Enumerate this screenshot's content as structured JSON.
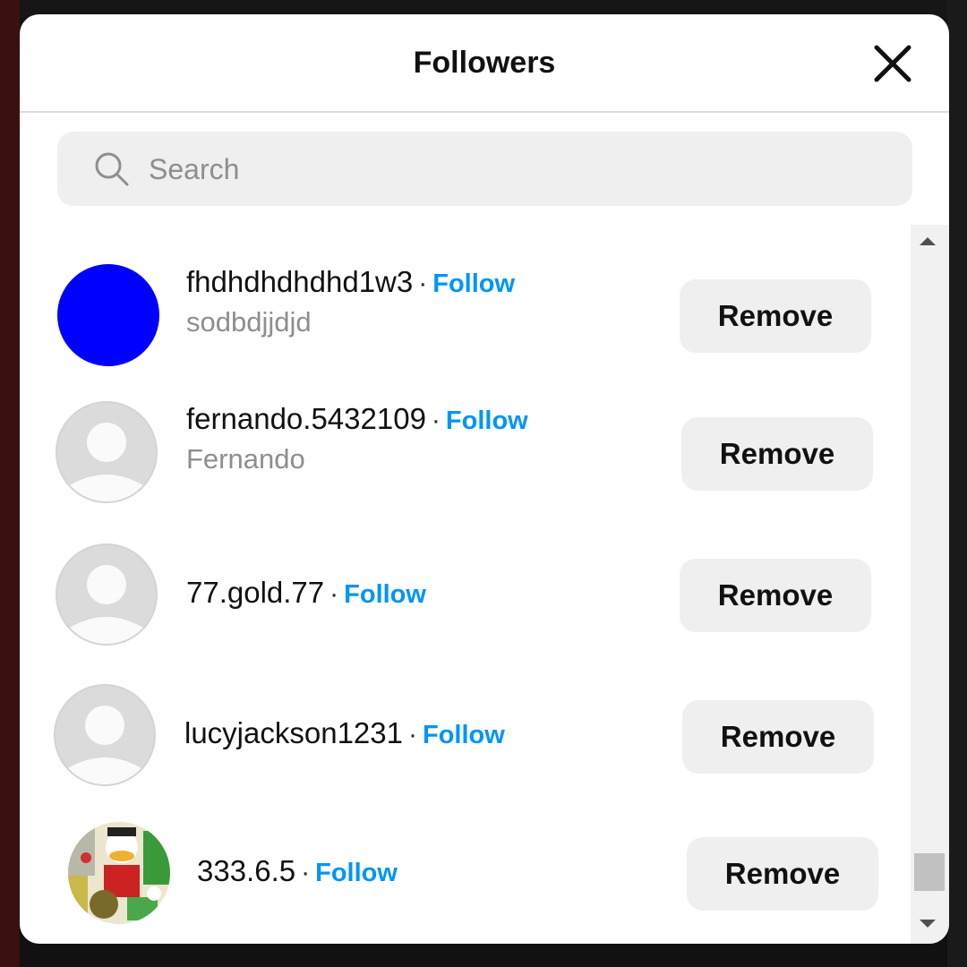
{
  "modal": {
    "title": "Followers"
  },
  "search": {
    "placeholder": "Search"
  },
  "separator": "·",
  "followers": [
    {
      "username": "fhdhdhdhdhd1w3",
      "follow_label": "Follow",
      "full_name": "sodbdjjdjd",
      "remove_label": "Remove",
      "avatar": "blue-circle"
    },
    {
      "username": "fernando.5432109",
      "follow_label": "Follow",
      "full_name": "Fernando",
      "remove_label": "Remove",
      "avatar": "default-avatar"
    },
    {
      "username": "77.gold.77",
      "follow_label": "Follow",
      "full_name": "",
      "remove_label": "Remove",
      "avatar": "default-avatar"
    },
    {
      "username": "lucyjackson1231",
      "follow_label": "Follow",
      "full_name": "",
      "remove_label": "Remove",
      "avatar": "default-avatar"
    },
    {
      "username": "333.6.5",
      "follow_label": "Follow",
      "full_name": "",
      "remove_label": "Remove",
      "avatar": "cartoon-duck-photo"
    }
  ],
  "colors": {
    "follow_link": "#0095f6",
    "button_bg": "#efefef",
    "avatar_blue": "#0000ff",
    "secondary_text": "#8e8e8e"
  },
  "icons": {
    "close": "close-x-icon",
    "search": "search-icon",
    "default_avatar": "user-silhouette-icon"
  }
}
